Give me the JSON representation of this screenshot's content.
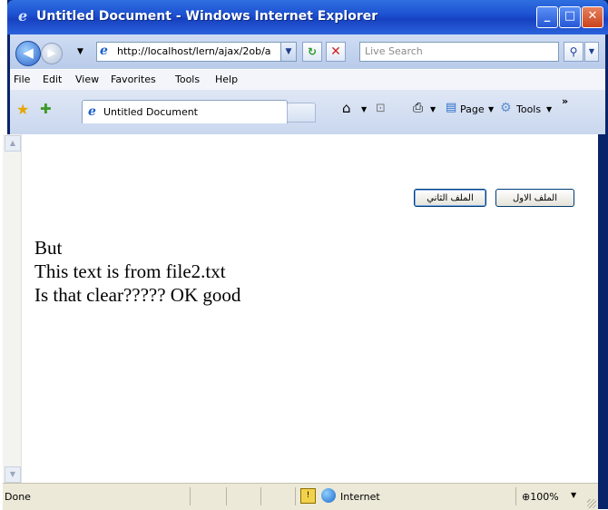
{
  "window": {
    "title": "Untitled Document - Windows Internet Explorer",
    "buttons": {
      "minimize": "_",
      "maximize": "□",
      "close": "✕"
    }
  },
  "address": {
    "url": "http://localhost/lern/ajax/2ob/a",
    "dropdown": "▼"
  },
  "search": {
    "placeholder": "Live Search"
  },
  "menu": {
    "items": [
      "File",
      "Edit",
      "View",
      "Favorites",
      "Tools",
      "Help"
    ]
  },
  "tab": {
    "label": "Untitled Document"
  },
  "command_bar": {
    "page": "Page",
    "tools": "Tools",
    "chevron": "»"
  },
  "content": {
    "button_first": "الملف الاول",
    "button_second": "الملف الثاني",
    "lines": [
      "But",
      "This text is from file2.txt",
      "Is that clear????? OK good"
    ]
  },
  "status": {
    "text": "Done",
    "zone": "Internet",
    "zoom": "100%"
  },
  "colors": {
    "titlebar": "#1c4fd0",
    "accent": "#0a246a",
    "button_border": "#003c74"
  },
  "icons": [
    "ie-icon",
    "back-icon",
    "forward-icon",
    "refresh-icon",
    "stop-icon",
    "search-icon",
    "favorites-star-icon",
    "add-favorites-icon",
    "home-icon",
    "feeds-icon",
    "print-icon",
    "page-icon",
    "tools-gear-icon",
    "globe-icon",
    "lock-icon",
    "zoom-icon"
  ]
}
